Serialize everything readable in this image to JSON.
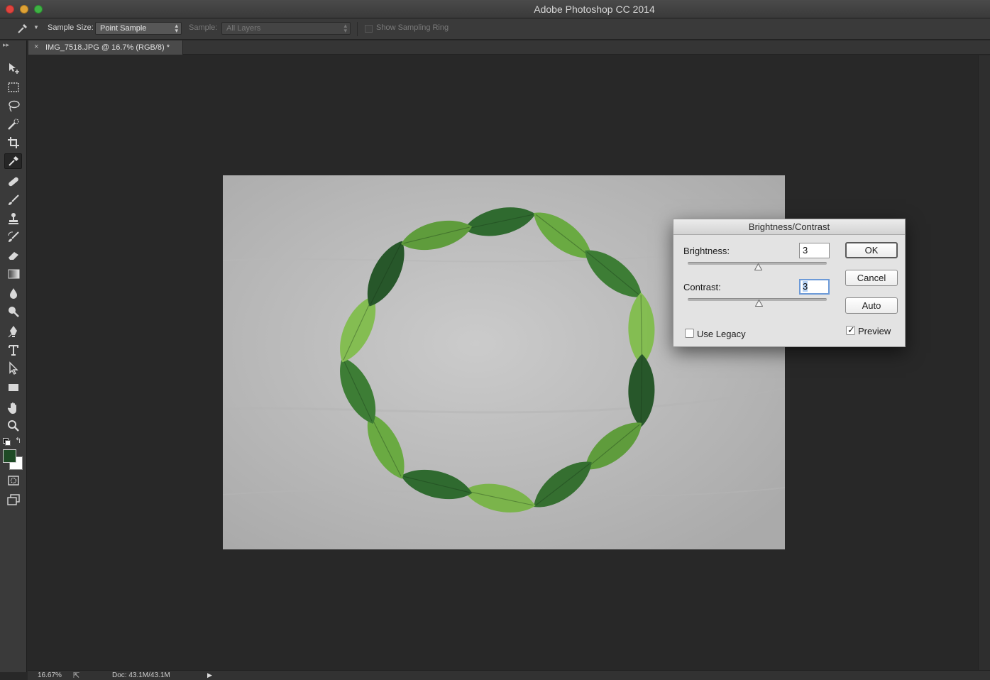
{
  "window": {
    "title": "Adobe Photoshop CC 2014"
  },
  "options_bar": {
    "sample_size_label": "Sample Size:",
    "sample_size_value": "Point Sample",
    "sample_label": "Sample:",
    "sample_value": "All Layers",
    "show_sampling_ring_label": "Show Sampling Ring",
    "show_sampling_ring_checked": false
  },
  "document_tab": {
    "label": "IMG_7518.JPG @ 16.7% (RGB/8) *"
  },
  "tools": [
    {
      "name": "move-tool",
      "icon": "move-icon"
    },
    {
      "name": "marquee-tool",
      "icon": "rectangular-marquee-icon"
    },
    {
      "name": "lasso-tool",
      "icon": "lasso-icon"
    },
    {
      "name": "quick-selection-tool",
      "icon": "quick-selection-icon"
    },
    {
      "name": "crop-tool",
      "icon": "crop-icon"
    },
    {
      "name": "eyedropper-tool",
      "icon": "eyedropper-icon",
      "active": true
    },
    {
      "name": "healing-brush-tool",
      "icon": "bandage-icon"
    },
    {
      "name": "brush-tool",
      "icon": "brush-icon"
    },
    {
      "name": "clone-stamp-tool",
      "icon": "stamp-icon"
    },
    {
      "name": "history-brush-tool",
      "icon": "history-brush-icon"
    },
    {
      "name": "eraser-tool",
      "icon": "eraser-icon"
    },
    {
      "name": "gradient-tool",
      "icon": "gradient-icon"
    },
    {
      "name": "blur-tool",
      "icon": "droplet-icon"
    },
    {
      "name": "dodge-tool",
      "icon": "dodge-icon"
    },
    {
      "name": "pen-tool",
      "icon": "pen-icon"
    },
    {
      "name": "type-tool",
      "icon": "type-icon"
    },
    {
      "name": "path-selection-tool",
      "icon": "arrow-pointer-icon"
    },
    {
      "name": "shape-tool",
      "icon": "rectangle-icon"
    },
    {
      "name": "hand-tool",
      "icon": "hand-icon"
    },
    {
      "name": "zoom-tool",
      "icon": "magnifier-icon"
    }
  ],
  "colors": {
    "foreground": "#1e4a25",
    "background": "#ffffff"
  },
  "status_bar": {
    "zoom": "16.67%",
    "doc_info": "Doc: 43.1M/43.1M"
  },
  "dialog": {
    "title": "Brightness/Contrast",
    "brightness_label": "Brightness:",
    "brightness_value": "3",
    "contrast_label": "Contrast:",
    "contrast_value": "3",
    "ok_label": "OK",
    "cancel_label": "Cancel",
    "auto_label": "Auto",
    "use_legacy_label": "Use Legacy",
    "use_legacy_checked": false,
    "preview_label": "Preview",
    "preview_checked": true
  }
}
